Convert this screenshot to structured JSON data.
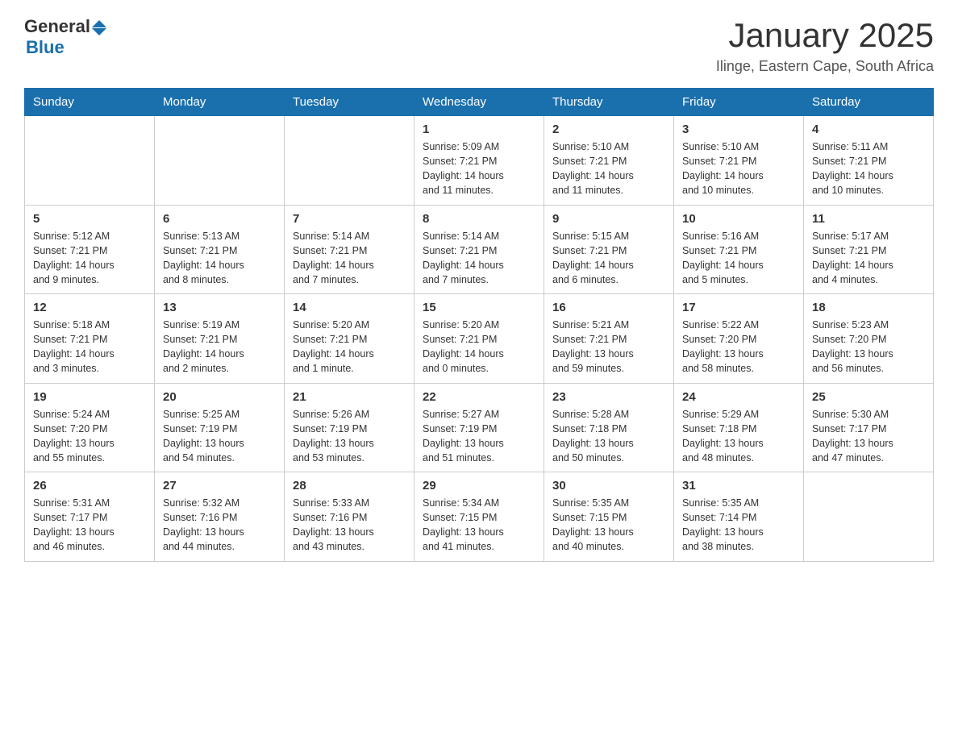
{
  "header": {
    "logo": {
      "general": "General",
      "blue": "Blue"
    },
    "title": "January 2025",
    "location": "Ilinge, Eastern Cape, South Africa"
  },
  "weekdays": [
    "Sunday",
    "Monday",
    "Tuesday",
    "Wednesday",
    "Thursday",
    "Friday",
    "Saturday"
  ],
  "weeks": [
    [
      {
        "day": "",
        "info": ""
      },
      {
        "day": "",
        "info": ""
      },
      {
        "day": "",
        "info": ""
      },
      {
        "day": "1",
        "info": "Sunrise: 5:09 AM\nSunset: 7:21 PM\nDaylight: 14 hours\nand 11 minutes."
      },
      {
        "day": "2",
        "info": "Sunrise: 5:10 AM\nSunset: 7:21 PM\nDaylight: 14 hours\nand 11 minutes."
      },
      {
        "day": "3",
        "info": "Sunrise: 5:10 AM\nSunset: 7:21 PM\nDaylight: 14 hours\nand 10 minutes."
      },
      {
        "day": "4",
        "info": "Sunrise: 5:11 AM\nSunset: 7:21 PM\nDaylight: 14 hours\nand 10 minutes."
      }
    ],
    [
      {
        "day": "5",
        "info": "Sunrise: 5:12 AM\nSunset: 7:21 PM\nDaylight: 14 hours\nand 9 minutes."
      },
      {
        "day": "6",
        "info": "Sunrise: 5:13 AM\nSunset: 7:21 PM\nDaylight: 14 hours\nand 8 minutes."
      },
      {
        "day": "7",
        "info": "Sunrise: 5:14 AM\nSunset: 7:21 PM\nDaylight: 14 hours\nand 7 minutes."
      },
      {
        "day": "8",
        "info": "Sunrise: 5:14 AM\nSunset: 7:21 PM\nDaylight: 14 hours\nand 7 minutes."
      },
      {
        "day": "9",
        "info": "Sunrise: 5:15 AM\nSunset: 7:21 PM\nDaylight: 14 hours\nand 6 minutes."
      },
      {
        "day": "10",
        "info": "Sunrise: 5:16 AM\nSunset: 7:21 PM\nDaylight: 14 hours\nand 5 minutes."
      },
      {
        "day": "11",
        "info": "Sunrise: 5:17 AM\nSunset: 7:21 PM\nDaylight: 14 hours\nand 4 minutes."
      }
    ],
    [
      {
        "day": "12",
        "info": "Sunrise: 5:18 AM\nSunset: 7:21 PM\nDaylight: 14 hours\nand 3 minutes."
      },
      {
        "day": "13",
        "info": "Sunrise: 5:19 AM\nSunset: 7:21 PM\nDaylight: 14 hours\nand 2 minutes."
      },
      {
        "day": "14",
        "info": "Sunrise: 5:20 AM\nSunset: 7:21 PM\nDaylight: 14 hours\nand 1 minute."
      },
      {
        "day": "15",
        "info": "Sunrise: 5:20 AM\nSunset: 7:21 PM\nDaylight: 14 hours\nand 0 minutes."
      },
      {
        "day": "16",
        "info": "Sunrise: 5:21 AM\nSunset: 7:21 PM\nDaylight: 13 hours\nand 59 minutes."
      },
      {
        "day": "17",
        "info": "Sunrise: 5:22 AM\nSunset: 7:20 PM\nDaylight: 13 hours\nand 58 minutes."
      },
      {
        "day": "18",
        "info": "Sunrise: 5:23 AM\nSunset: 7:20 PM\nDaylight: 13 hours\nand 56 minutes."
      }
    ],
    [
      {
        "day": "19",
        "info": "Sunrise: 5:24 AM\nSunset: 7:20 PM\nDaylight: 13 hours\nand 55 minutes."
      },
      {
        "day": "20",
        "info": "Sunrise: 5:25 AM\nSunset: 7:19 PM\nDaylight: 13 hours\nand 54 minutes."
      },
      {
        "day": "21",
        "info": "Sunrise: 5:26 AM\nSunset: 7:19 PM\nDaylight: 13 hours\nand 53 minutes."
      },
      {
        "day": "22",
        "info": "Sunrise: 5:27 AM\nSunset: 7:19 PM\nDaylight: 13 hours\nand 51 minutes."
      },
      {
        "day": "23",
        "info": "Sunrise: 5:28 AM\nSunset: 7:18 PM\nDaylight: 13 hours\nand 50 minutes."
      },
      {
        "day": "24",
        "info": "Sunrise: 5:29 AM\nSunset: 7:18 PM\nDaylight: 13 hours\nand 48 minutes."
      },
      {
        "day": "25",
        "info": "Sunrise: 5:30 AM\nSunset: 7:17 PM\nDaylight: 13 hours\nand 47 minutes."
      }
    ],
    [
      {
        "day": "26",
        "info": "Sunrise: 5:31 AM\nSunset: 7:17 PM\nDaylight: 13 hours\nand 46 minutes."
      },
      {
        "day": "27",
        "info": "Sunrise: 5:32 AM\nSunset: 7:16 PM\nDaylight: 13 hours\nand 44 minutes."
      },
      {
        "day": "28",
        "info": "Sunrise: 5:33 AM\nSunset: 7:16 PM\nDaylight: 13 hours\nand 43 minutes."
      },
      {
        "day": "29",
        "info": "Sunrise: 5:34 AM\nSunset: 7:15 PM\nDaylight: 13 hours\nand 41 minutes."
      },
      {
        "day": "30",
        "info": "Sunrise: 5:35 AM\nSunset: 7:15 PM\nDaylight: 13 hours\nand 40 minutes."
      },
      {
        "day": "31",
        "info": "Sunrise: 5:35 AM\nSunset: 7:14 PM\nDaylight: 13 hours\nand 38 minutes."
      },
      {
        "day": "",
        "info": ""
      }
    ]
  ]
}
